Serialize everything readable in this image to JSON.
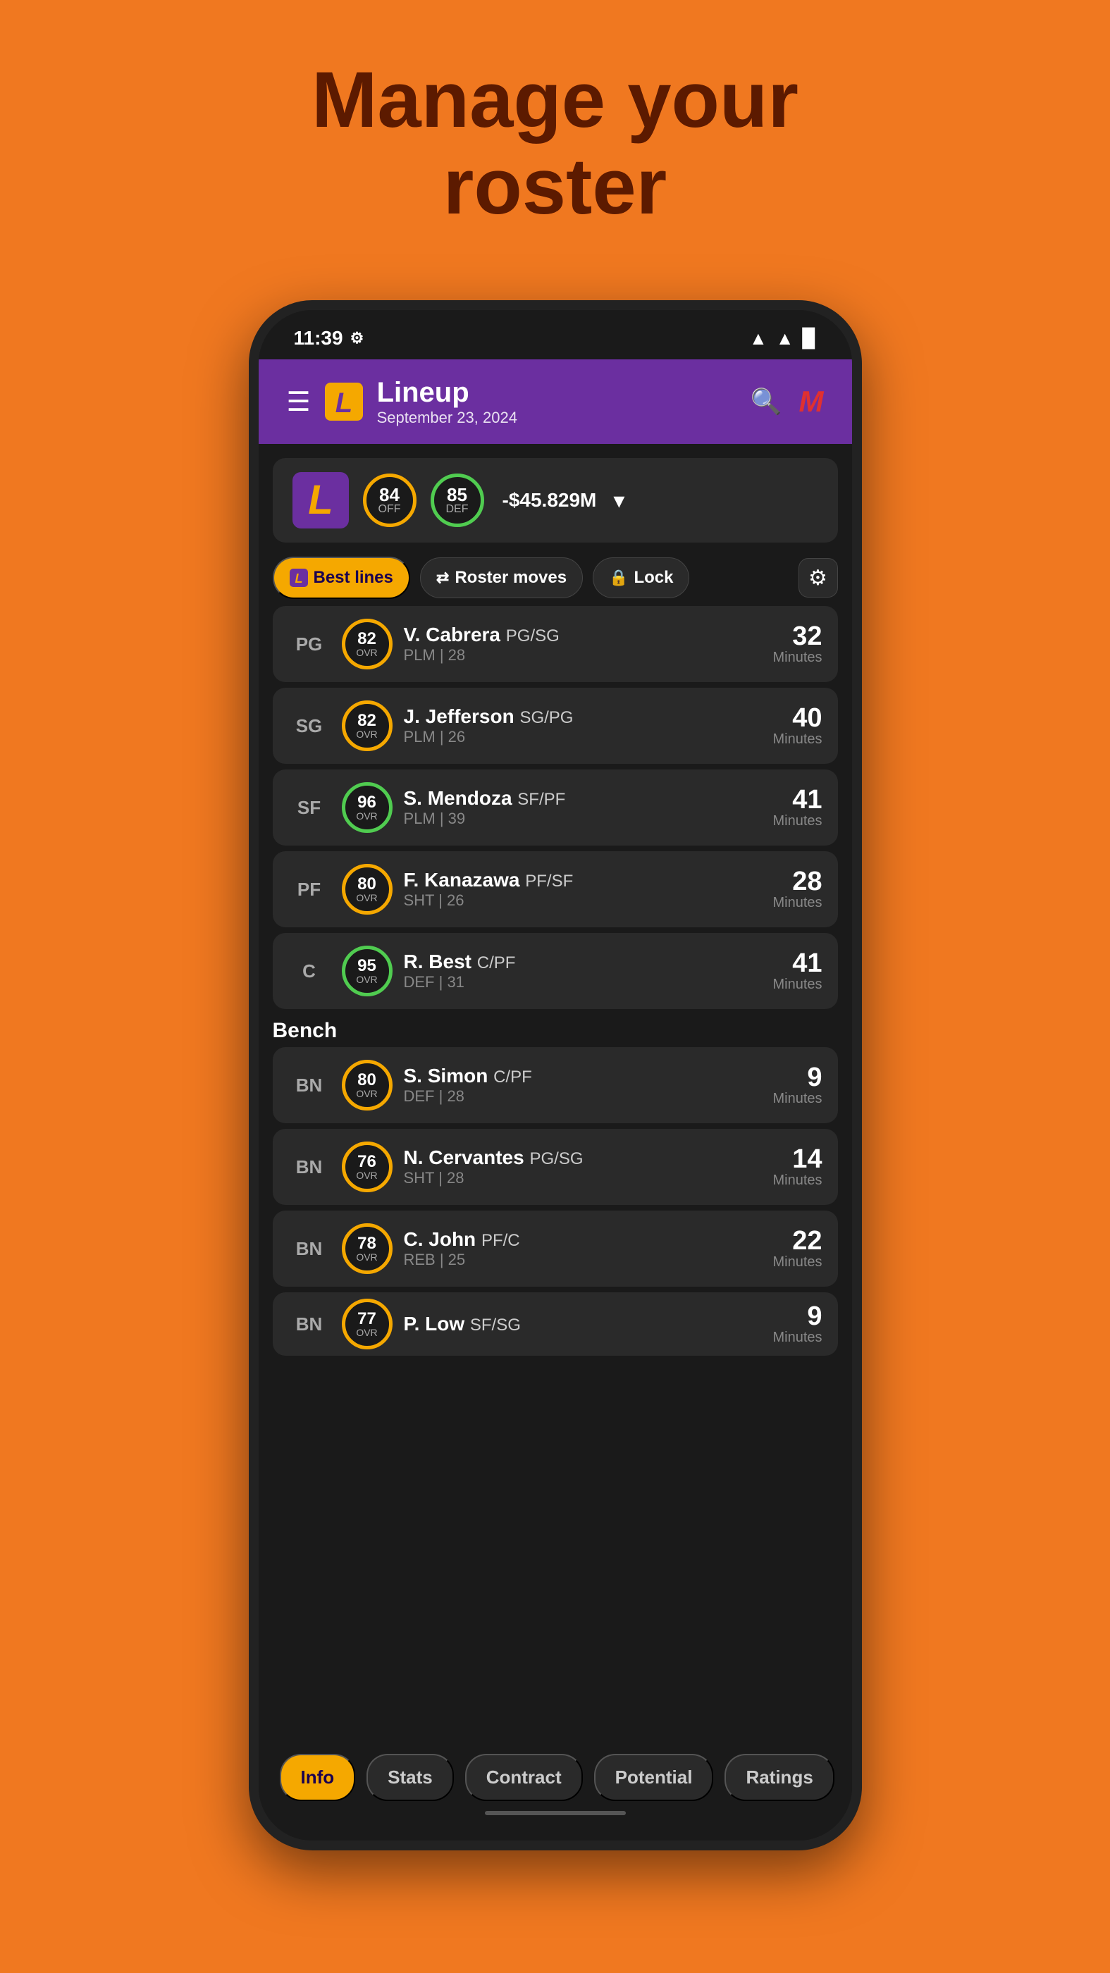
{
  "page": {
    "title_line1": "Manage your",
    "title_line2": "roster",
    "background_color": "#F07820"
  },
  "status_bar": {
    "time": "11:39",
    "settings_icon": "⚙",
    "wifi": "▲",
    "signal": "▲",
    "battery": "▉"
  },
  "header": {
    "menu_icon": "☰",
    "logo_letter": "L",
    "title": "Lineup",
    "subtitle": "September 23, 2024",
    "search_icon": "🔍",
    "profile_letter": "M"
  },
  "team_summary": {
    "logo_letter": "L",
    "offense_rating": "84",
    "offense_label": "OFF",
    "defense_rating": "85",
    "defense_label": "DEF",
    "salary": "-$45.829M"
  },
  "action_bar": {
    "best_lines_label": "Best lines",
    "roster_moves_label": "Roster moves",
    "lock_label": "Lock",
    "settings_icon": "⚙"
  },
  "starters": [
    {
      "position": "PG",
      "ovr": "82",
      "ovr_class": "ovr-82",
      "name": "V. Cabrera",
      "positions": "PG/SG",
      "detail": "PLM | 28",
      "minutes": "32",
      "minutes_label": "Minutes"
    },
    {
      "position": "SG",
      "ovr": "82",
      "ovr_class": "ovr-82",
      "name": "J. Jefferson",
      "positions": "SG/PG",
      "detail": "PLM | 26",
      "minutes": "40",
      "minutes_label": "Minutes"
    },
    {
      "position": "SF",
      "ovr": "96",
      "ovr_class": "ovr-96",
      "name": "S. Mendoza",
      "positions": "SF/PF",
      "detail": "PLM | 39",
      "minutes": "41",
      "minutes_label": "Minutes"
    },
    {
      "position": "PF",
      "ovr": "80",
      "ovr_class": "ovr-80",
      "name": "F. Kanazawa",
      "positions": "PF/SF",
      "detail": "SHT | 26",
      "minutes": "28",
      "minutes_label": "Minutes"
    },
    {
      "position": "C",
      "ovr": "95",
      "ovr_class": "ovr-95",
      "name": "R. Best",
      "positions": "C/PF",
      "detail": "DEF | 31",
      "minutes": "41",
      "minutes_label": "Minutes"
    }
  ],
  "bench_label": "Bench",
  "bench": [
    {
      "position": "BN",
      "ovr": "80",
      "ovr_class": "ovr-80",
      "name": "S. Simon",
      "positions": "C/PF",
      "detail": "DEF | 28",
      "minutes": "9",
      "minutes_label": "Minutes"
    },
    {
      "position": "BN",
      "ovr": "76",
      "ovr_class": "ovr-76",
      "name": "N. Cervantes",
      "positions": "PG/SG",
      "detail": "SHT | 28",
      "minutes": "14",
      "minutes_label": "Minutes"
    },
    {
      "position": "BN",
      "ovr": "78",
      "ovr_class": "ovr-78",
      "name": "C. John",
      "positions": "PF/C",
      "detail": "REB | 25",
      "minutes": "22",
      "minutes_label": "Minutes"
    },
    {
      "position": "BN",
      "ovr": "77",
      "ovr_class": "ovr-77",
      "name": "P. Low",
      "positions": "SF/SG",
      "detail": "",
      "minutes": "9",
      "minutes_label": "Minutes"
    }
  ],
  "bottom_tabs": [
    {
      "label": "Info",
      "active": true
    },
    {
      "label": "Stats",
      "active": false
    },
    {
      "label": "Contract",
      "active": false
    },
    {
      "label": "Potential",
      "active": false
    },
    {
      "label": "Ratings",
      "active": false
    }
  ]
}
